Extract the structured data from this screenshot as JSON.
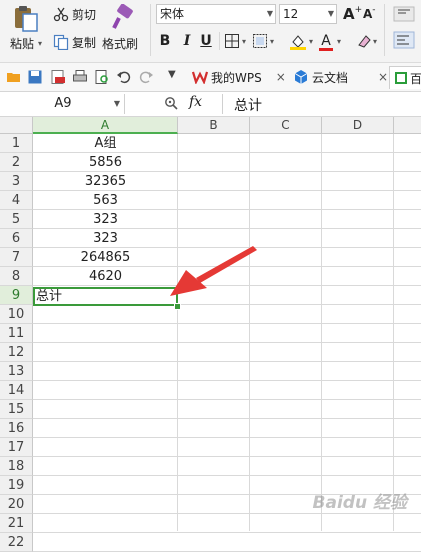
{
  "ribbon": {
    "paste_label": "粘贴",
    "cut_label": "剪切",
    "copy_label": "复制",
    "format_painter_label": "格式刷",
    "font_name": "宋体",
    "font_size": "12",
    "bold": "B",
    "italic": "I",
    "underline": "U",
    "font_color": "A",
    "grow_font": "A",
    "shrink_font": "A",
    "grow_sign": "+",
    "shrink_sign": "-"
  },
  "tabs": [
    {
      "label": "我的WPS",
      "close": "×"
    },
    {
      "label": "云文档",
      "close": "×"
    },
    {
      "label": "百"
    }
  ],
  "formula_bar": {
    "name_box": "A9",
    "fx": "fx",
    "content": "总计"
  },
  "columns": [
    "A",
    "B",
    "C",
    "D"
  ],
  "rows": [
    "1",
    "2",
    "3",
    "4",
    "5",
    "6",
    "7",
    "8",
    "9",
    "10",
    "11",
    "12",
    "13",
    "14",
    "15",
    "16",
    "17",
    "18",
    "19",
    "20",
    "21",
    "22"
  ],
  "cells": {
    "A1": "A组",
    "A2": "5856",
    "A3": "32365",
    "A4": "563",
    "A5": "323",
    "A6": "323",
    "A7": "264865",
    "A8": "4620",
    "A9": "总计"
  },
  "selection": "A9",
  "colors": {
    "selection": "#3a9a3a",
    "arrow": "#e53935",
    "wps_red": "#d32f2f",
    "cloud_blue": "#2a7bd6"
  },
  "watermark": "Baidu 经验"
}
